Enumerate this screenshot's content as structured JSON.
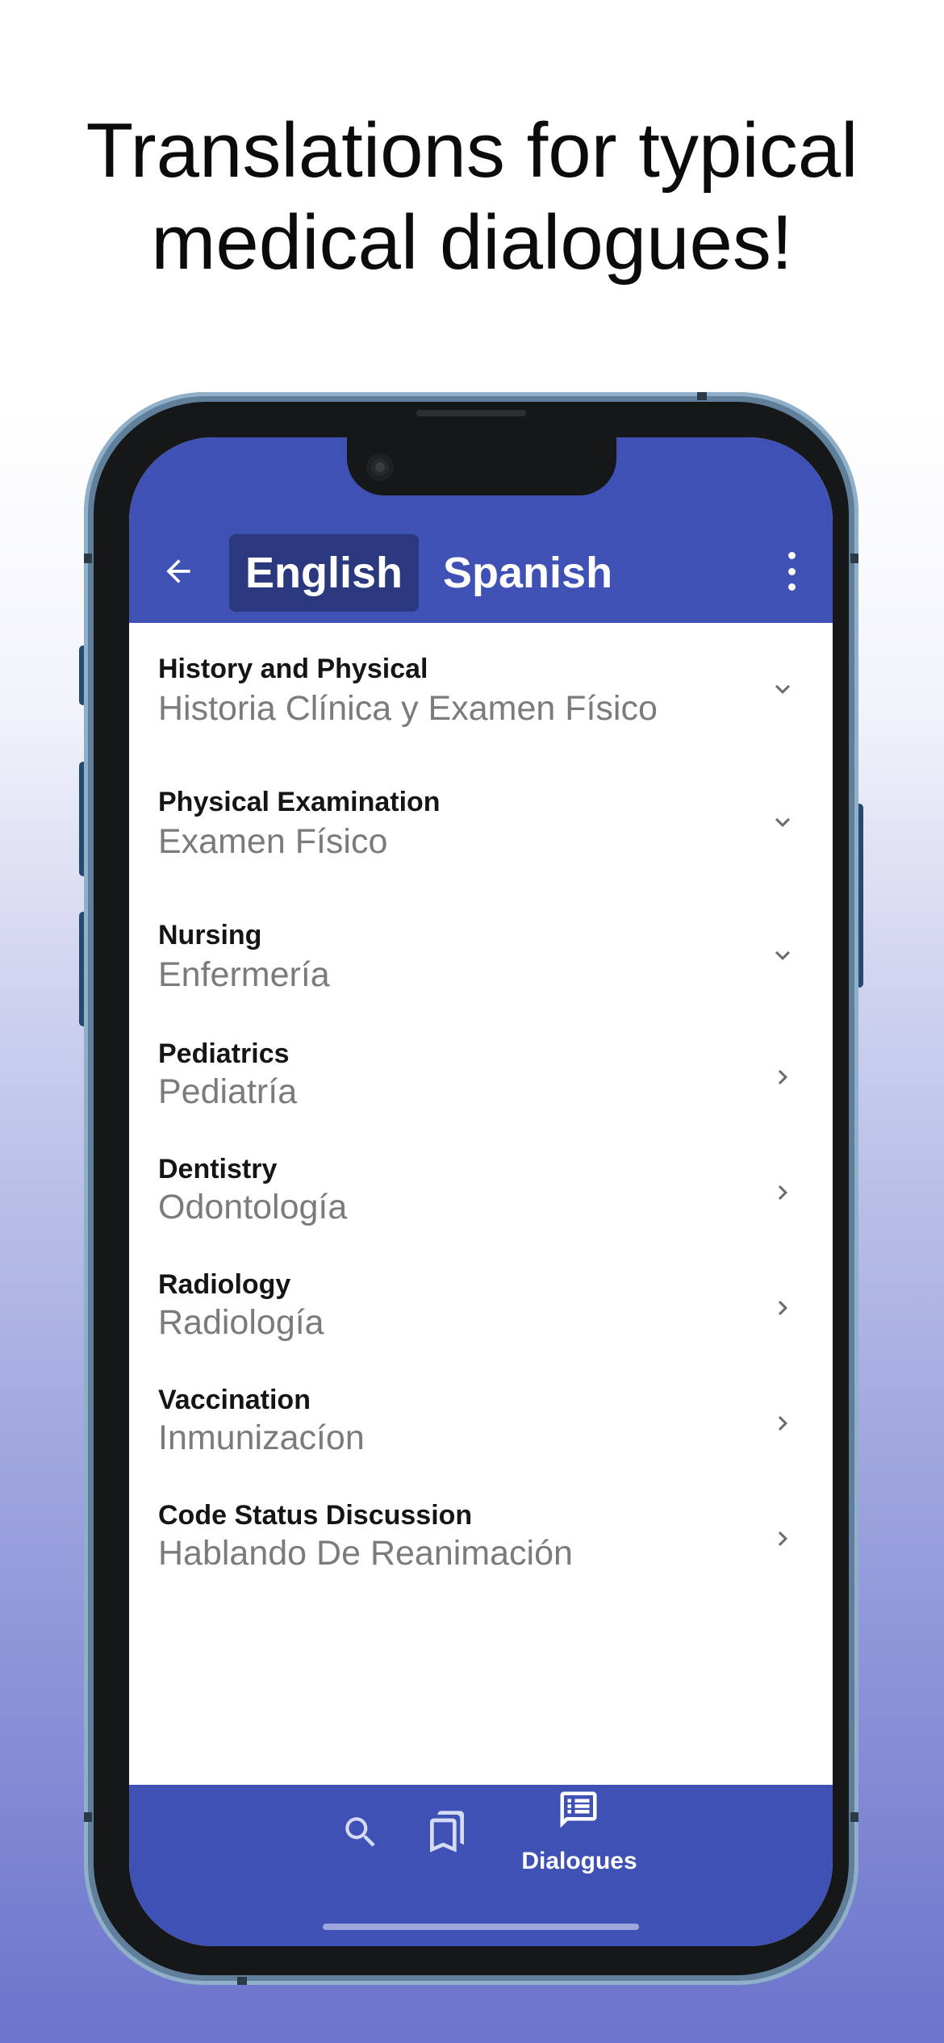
{
  "headline": {
    "line1": "Translations for typical",
    "line2": "medical dialogues!"
  },
  "appbar": {
    "back_icon": "arrow-left-icon",
    "source_language": "English",
    "target_language": "Spanish",
    "menu_icon": "more-vert-icon",
    "color": "#3f51b5",
    "active_pill_color": "#2a387d"
  },
  "dialogue_list": [
    {
      "english": "History and Physical",
      "spanish": "Historia Clínica y Examen Físico",
      "icon": "chevron-down-icon"
    },
    {
      "english": "Physical Examination",
      "spanish": "Examen Físico",
      "icon": "chevron-down-icon"
    },
    {
      "english": "Nursing",
      "spanish": "Enfermería",
      "icon": "chevron-down-icon"
    },
    {
      "english": "Pediatrics",
      "spanish": "Pediatría",
      "icon": "chevron-right-icon"
    },
    {
      "english": "Dentistry",
      "spanish": "Odontología",
      "icon": "chevron-right-icon"
    },
    {
      "english": "Radiology",
      "spanish": "Radiología",
      "icon": "chevron-right-icon"
    },
    {
      "english": "Vaccination",
      "spanish": "Inmunizacíon",
      "icon": "chevron-right-icon"
    },
    {
      "english": "Code Status Discussion",
      "spanish": "Hablando De Reanimación",
      "icon": "chevron-right-icon"
    }
  ],
  "bottom_nav": {
    "items": [
      {
        "icon": "search-icon",
        "label": ""
      },
      {
        "icon": "bookmarks-icon",
        "label": ""
      },
      {
        "icon": "dialogues-icon",
        "label": "Dialogues",
        "selected": true
      }
    ]
  }
}
